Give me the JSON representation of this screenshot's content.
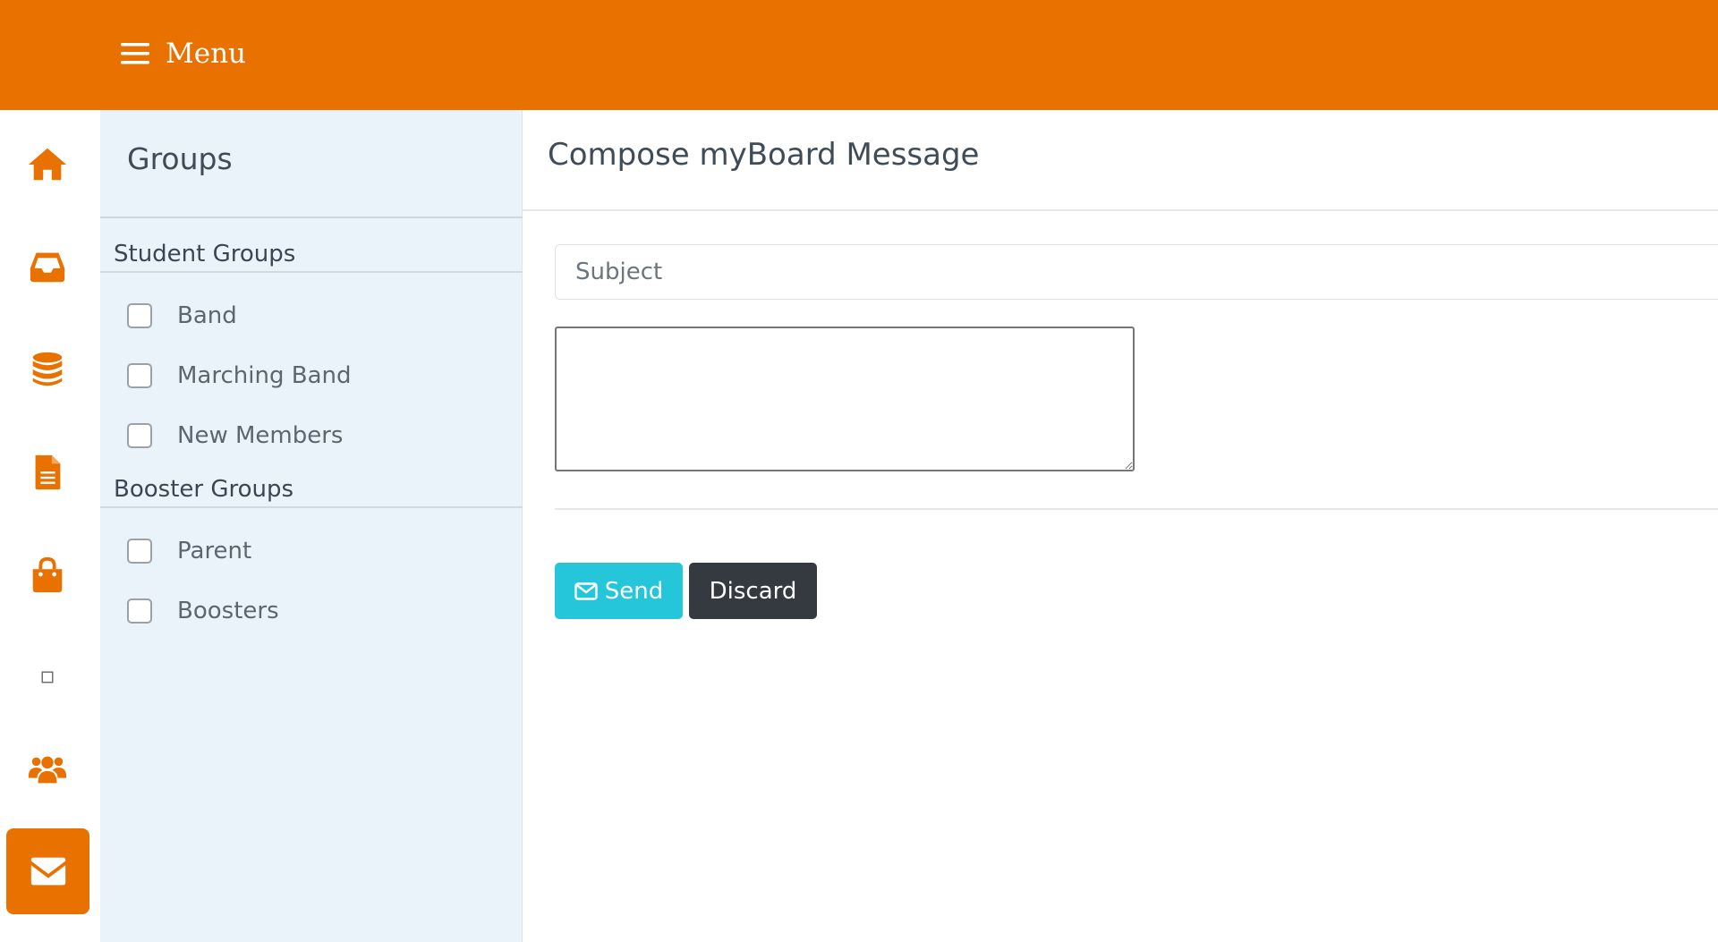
{
  "header": {
    "menu_label": "Menu",
    "menu_icon": "hamburger-icon",
    "background_color": "#e87100"
  },
  "rail": {
    "items": [
      {
        "icon": "home-icon"
      },
      {
        "icon": "inbox-icon"
      },
      {
        "icon": "database-icon"
      },
      {
        "icon": "file-text-icon"
      },
      {
        "icon": "shopping-bag-icon"
      },
      {
        "icon": "square-icon"
      },
      {
        "icon": "users-icon"
      },
      {
        "icon": "envelope-icon",
        "active": true
      }
    ],
    "accent_color": "#e87100"
  },
  "groups": {
    "title": "Groups",
    "sections": [
      {
        "heading": "Student Groups",
        "items": [
          {
            "label": "Band",
            "checked": false
          },
          {
            "label": "Marching Band",
            "checked": false
          },
          {
            "label": "New Members",
            "checked": false
          }
        ]
      },
      {
        "heading": "Booster Groups",
        "items": [
          {
            "label": "Parent",
            "checked": false
          },
          {
            "label": "Boosters",
            "checked": false
          }
        ]
      }
    ]
  },
  "compose": {
    "title": "Compose myBoard Message",
    "subject_placeholder": "Subject",
    "subject_value": "",
    "message_value": "",
    "send_label": "Send",
    "send_icon": "envelope-outline-icon",
    "discard_label": "Discard",
    "send_color": "#26c6da",
    "discard_color": "#343a40"
  }
}
